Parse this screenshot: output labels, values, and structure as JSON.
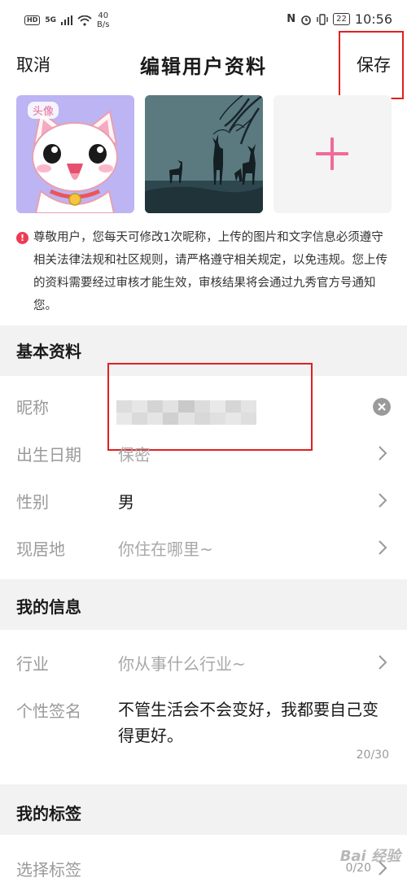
{
  "status_bar": {
    "hd": "HD",
    "signal": "5G",
    "speed_value": "40",
    "speed_unit": "B/s",
    "battery": "22",
    "time": "10:56"
  },
  "header": {
    "cancel_label": "取消",
    "title": "编辑用户资料",
    "save_label": "保存"
  },
  "photos": {
    "avatar_tag": "头像"
  },
  "notice": {
    "icon": "!",
    "text": "尊敬用户，您每天可修改1次昵称，上传的图片和文字信息必须遵守相关法律法规和社区规则，请严格遵守相关规定，以免违规。您上传的资料需要经过审核才能生效，审核结果将会通过九秀官方号通知您。"
  },
  "basic_section": {
    "title": "基本资料",
    "nickname_label": "昵称",
    "birthday_label": "出生日期",
    "birthday_value": "保密",
    "gender_label": "性别",
    "gender_value": "男",
    "location_label": "现居地",
    "location_placeholder": "你住在哪里~"
  },
  "info_section": {
    "title": "我的信息",
    "industry_label": "行业",
    "industry_placeholder": "你从事什么行业~",
    "signature_label": "个性签名",
    "signature_value": "不管生活会不会变好，我都要自己变得更好。",
    "signature_count": "20/30"
  },
  "tags_section": {
    "title": "我的标签",
    "select_label": "选择标签",
    "select_count": "0/20"
  },
  "watermark": "Bai 经验",
  "colors": {
    "accent": "#f06a9a",
    "highlight_box": "#e02020",
    "section_bg": "#f2f2f2",
    "notice_icon": "#ee3b55"
  }
}
